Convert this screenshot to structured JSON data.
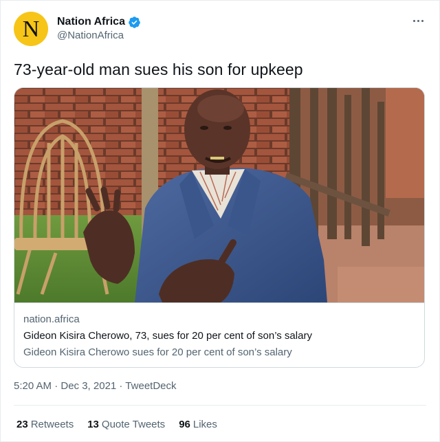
{
  "author": {
    "display_name": "Nation Africa",
    "handle": "@NationAfrica",
    "avatar_letter": "N",
    "avatar_color": "#f6c518",
    "verified": true,
    "verified_color": "#1d9bf0"
  },
  "tweet": {
    "text": "73-year-old man sues his son for upkeep",
    "timestamp": "5:20 AM · Dec 3, 2021 · TweetDeck"
  },
  "card": {
    "image_alt": "photo-elderly-man-in-blue-suit-gesturing",
    "domain": "nation.africa",
    "title": "Gideon Kisira Cherowo, 73, sues for 20 per cent of son’s salary",
    "description": "Gideon Kisira Cherowo sues for 20 per cent of son’s salary"
  },
  "stats": {
    "retweets_count": "23",
    "retweets_label": "Retweets",
    "quote_tweets_count": "13",
    "quote_tweets_label": "Quote Tweets",
    "likes_count": "96",
    "likes_label": "Likes"
  },
  "icons": {
    "more": "more-icon",
    "verified": "verified-badge-icon"
  }
}
